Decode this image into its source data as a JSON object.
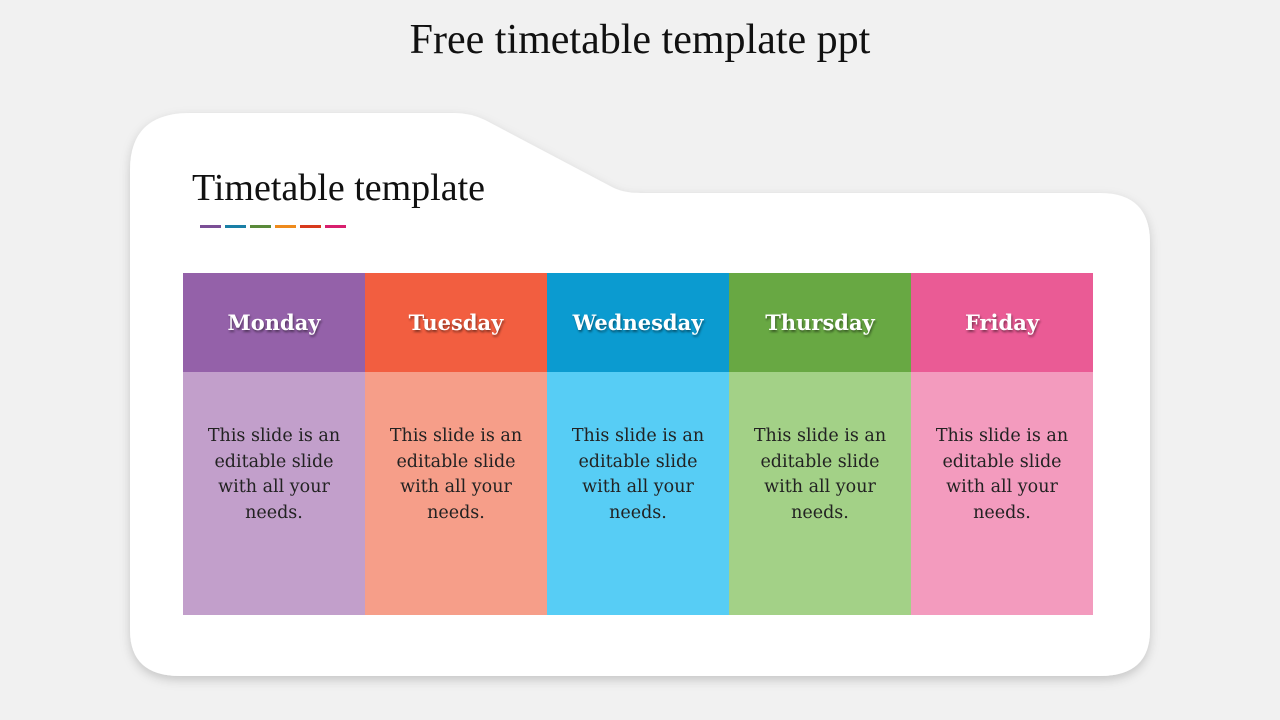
{
  "page": {
    "title": "Free timetable template ppt"
  },
  "card": {
    "title": "Timetable template"
  },
  "accent_bars": [
    "#7b4f96",
    "#1a7fa6",
    "#5a8a3a",
    "#ee8a1c",
    "#d83a1c",
    "#d81f6e"
  ],
  "days": [
    {
      "name": "Monday",
      "text": "This slide is an editable slide with all your needs.",
      "head_color": "#9461a9",
      "body_color": "#c29fcb"
    },
    {
      "name": "Tuesday",
      "text": "This slide is an editable slide with all your needs.",
      "head_color": "#f25e40",
      "body_color": "#f69e89"
    },
    {
      "name": "Wednesday",
      "text": "This slide is an editable slide with all your needs.",
      "head_color": "#0b9bd0",
      "body_color": "#57cdf5"
    },
    {
      "name": "Thursday",
      "text": "This slide is an editable slide with all your needs.",
      "head_color": "#68a843",
      "body_color": "#a3d187"
    },
    {
      "name": "Friday",
      "text": "This slide is an editable slide with all your needs.",
      "head_color": "#ea5b95",
      "body_color": "#f39bbe"
    }
  ]
}
